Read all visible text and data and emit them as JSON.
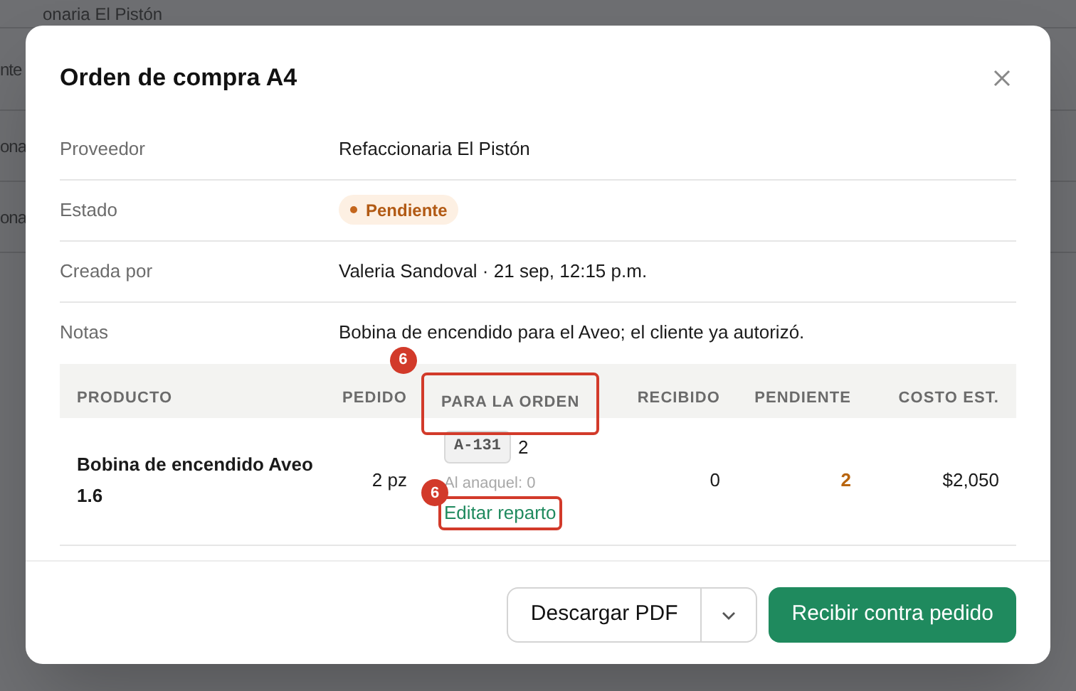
{
  "background": {
    "fragments": [
      "onaria El Pistón",
      "nte",
      "ona",
      "ona"
    ]
  },
  "dialog": {
    "title": "Orden de compra A4",
    "details": [
      {
        "kind": "text",
        "label": "Proveedor",
        "value": "Refaccionaria El Pistón"
      },
      {
        "kind": "badge",
        "label": "Estado",
        "value": "Pendiente"
      },
      {
        "kind": "text",
        "label": "Creada por",
        "value": "Valeria Sandoval · 21 sep, 12:15 p.m."
      },
      {
        "kind": "text",
        "label": "Notas",
        "value": "Bobina de encendido para el Aveo; el cliente ya autorizó."
      }
    ],
    "table": {
      "columns": [
        {
          "label": "PRODUCTO"
        },
        {
          "label": "PEDIDO"
        },
        {
          "label": "PARA LA ORDEN",
          "annotation": "6"
        },
        {
          "label": "RECIBIDO"
        },
        {
          "label": "PENDIENTE"
        },
        {
          "label": "COSTO EST."
        }
      ],
      "rows": [
        {
          "product": "Bobina de encendido Aveo 1.6",
          "ordered": "2 pz",
          "allocation": {
            "code": "A-131",
            "quantity": "2",
            "shelf": "Al anaquel: 0",
            "link": "Editar reparto",
            "link_annotation": "6"
          },
          "received": "0",
          "pending": "2",
          "cost": "$2,050"
        }
      ]
    },
    "footer": {
      "download": "Descargar PDF",
      "primary": "Recibir contra pedido"
    }
  }
}
